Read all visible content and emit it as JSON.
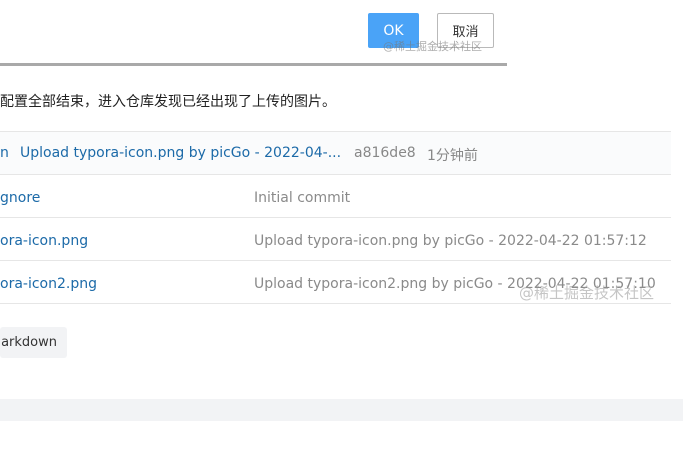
{
  "dialog": {
    "ok_label": "OK",
    "cancel_label": "取消",
    "watermark": "@稀土掘金技术社区"
  },
  "note": "配置全部结束，进入仓库发现已经出现了上传的图片。",
  "latest_commit": {
    "left_fragment": "n",
    "message": "Upload typora-icon.png by picGo - 2022-04-...",
    "hash": "a816de8",
    "time": "1分钟前"
  },
  "files": [
    {
      "name": "gnore",
      "message": "Initial commit"
    },
    {
      "name": "ora-icon.png",
      "message": "Upload typora-icon.png by picGo - 2022-04-22 01:57:12"
    },
    {
      "name": "ora-icon2.png",
      "message": "Upload typora-icon2.png by picGo - 2022-04-22 01:57:10"
    }
  ],
  "tag_label": "arkdown",
  "watermark": "@稀土掘金技术社区"
}
